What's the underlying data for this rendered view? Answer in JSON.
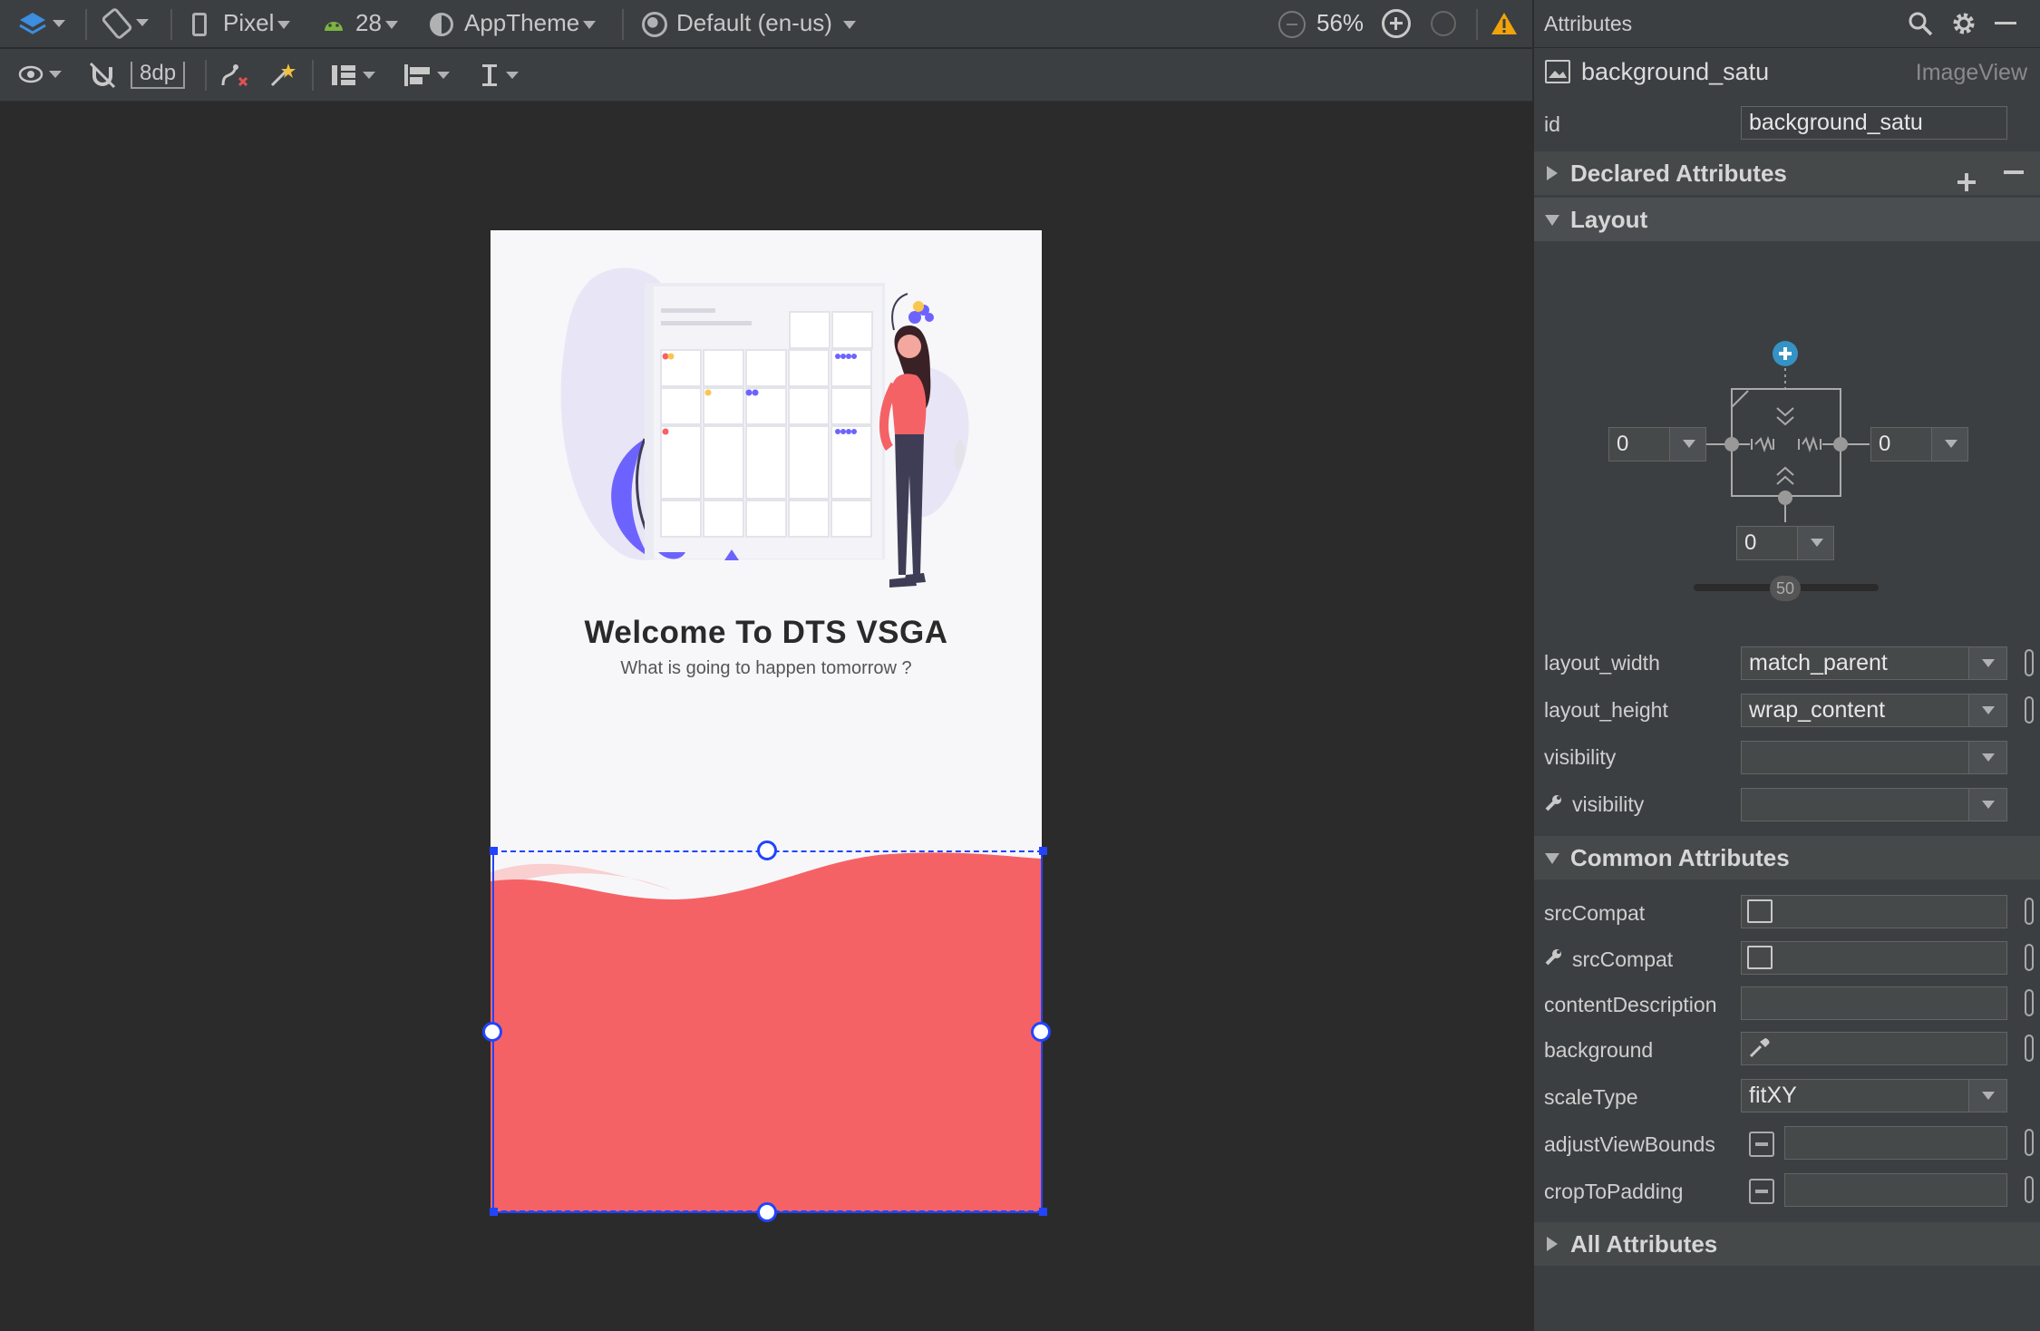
{
  "toolbar": {
    "device": "Pixel",
    "api": "28",
    "theme": "AppTheme",
    "locale": "Default (en-us)",
    "zoom": "56%",
    "margin": "8dp"
  },
  "preview": {
    "title": "Welcome To DTS VSGA",
    "subtitle": "What is going to happen tomorrow ?",
    "colors": {
      "wave": "#f56266",
      "wave_light": "#f9cfd0",
      "selection": "#2244ff"
    }
  },
  "panel": {
    "header": "Attributes",
    "component_name": "background_satu",
    "component_type": "ImageView",
    "id_label": "id",
    "id_value": "background_satu",
    "sections": {
      "declared": "Declared Attributes",
      "layout": "Layout",
      "common": "Common Attributes",
      "all": "All Attributes"
    },
    "constraints": {
      "left": "0",
      "right": "0",
      "bottom": "0",
      "bias": "50"
    },
    "layout_rows": [
      {
        "label": "layout_width",
        "value": "match_parent"
      },
      {
        "label": "layout_height",
        "value": "wrap_content"
      },
      {
        "label": "visibility",
        "value": ""
      },
      {
        "label": "visibility",
        "value": ""
      }
    ],
    "common_rows": [
      {
        "label": "srcCompat"
      },
      {
        "label": "srcCompat"
      },
      {
        "label": "contentDescription"
      },
      {
        "label": "background"
      },
      {
        "label": "scaleType",
        "value": "fitXY"
      },
      {
        "label": "adjustViewBounds"
      },
      {
        "label": "cropToPadding"
      }
    ]
  }
}
